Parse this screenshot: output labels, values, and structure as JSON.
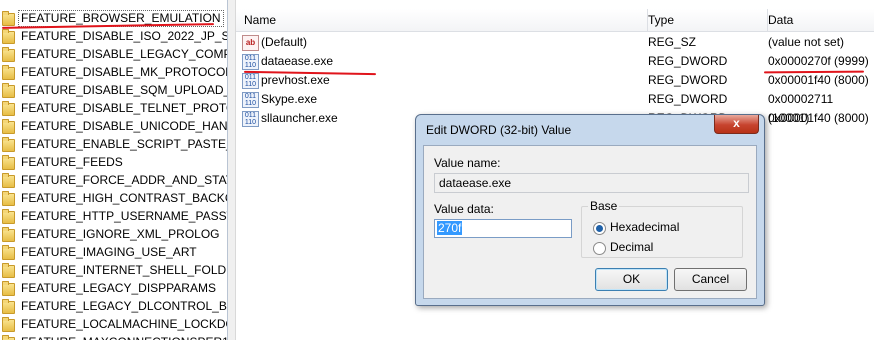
{
  "tree": {
    "items": [
      {
        "label": "FEATURE_BROWSER_EMULATION",
        "selected": true
      },
      {
        "label": "FEATURE_DISABLE_ISO_2022_JP_SNIF"
      },
      {
        "label": "FEATURE_DISABLE_LEGACY_COMPRE"
      },
      {
        "label": "FEATURE_DISABLE_MK_PROTOCOL"
      },
      {
        "label": "FEATURE_DISABLE_SQM_UPLOAD_FO"
      },
      {
        "label": "FEATURE_DISABLE_TELNET_PROTOC"
      },
      {
        "label": "FEATURE_DISABLE_UNICODE_HANDL"
      },
      {
        "label": "FEATURE_ENABLE_SCRIPT_PASTE_UF"
      },
      {
        "label": "FEATURE_FEEDS"
      },
      {
        "label": "FEATURE_FORCE_ADDR_AND_STATU"
      },
      {
        "label": "FEATURE_HIGH_CONTRAST_BACKGR"
      },
      {
        "label": "FEATURE_HTTP_USERNAME_PASSWO"
      },
      {
        "label": "FEATURE_IGNORE_XML_PROLOG"
      },
      {
        "label": "FEATURE_IMAGING_USE_ART"
      },
      {
        "label": "FEATURE_INTERNET_SHELL_FOLDERS"
      },
      {
        "label": "FEATURE_LEGACY_DISPPARAMS"
      },
      {
        "label": "FEATURE_LEGACY_DLCONTROL_BEH"
      },
      {
        "label": "FEATURE_LOCALMACHINE_LOCKDO"
      },
      {
        "label": "FEATURE_MAXCONNECTIONSPER1"
      }
    ]
  },
  "list": {
    "columns": [
      "Name",
      "Type",
      "Data"
    ],
    "rows": [
      {
        "name": "(Default)",
        "type": "REG_SZ",
        "data": "(value not set)",
        "icon": "ab"
      },
      {
        "name": "dataease.exe",
        "type": "REG_DWORD",
        "data": "0x0000270f (9999)",
        "icon": "bin"
      },
      {
        "name": "prevhost.exe",
        "type": "REG_DWORD",
        "data": "0x00001f40 (8000)",
        "icon": "bin"
      },
      {
        "name": "Skype.exe",
        "type": "REG_DWORD",
        "data": "0x00002711 (10001)",
        "icon": "bin"
      },
      {
        "name": "sllauncher.exe",
        "type": "REG_DWORD",
        "data": "0x00001f40 (8000)",
        "icon": "bin"
      }
    ],
    "icons": {
      "ab": "ab",
      "bin": "011\n110"
    }
  },
  "dialog": {
    "title": "Edit DWORD (32-bit) Value",
    "close_glyph": "x",
    "value_name_label": "Value name:",
    "value_name": "dataease.exe",
    "value_data_label": "Value data:",
    "value_data": "270f",
    "base_label": "Base",
    "hex_label": "Hexadecimal",
    "dec_label": "Decimal",
    "base_selected": "Hexadecimal",
    "ok_label": "OK",
    "cancel_label": "Cancel"
  },
  "colors": {
    "annotation": "#e0141b",
    "selection": "#3399ff"
  }
}
